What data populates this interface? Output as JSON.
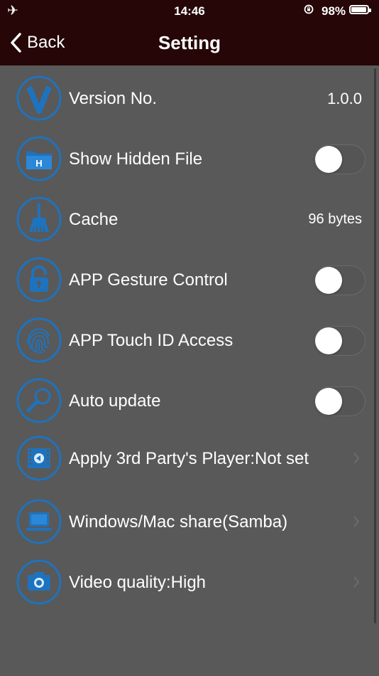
{
  "status_bar": {
    "time": "14:46",
    "battery_pct": "98%",
    "battery_level": 0.98
  },
  "nav": {
    "back_label": "Back",
    "title": "Setting"
  },
  "accent_color": "#1e73be",
  "rows": [
    {
      "icon": "version-v-icon",
      "label": "Version No.",
      "value": "1.0.0"
    },
    {
      "icon": "hidden-folder-icon",
      "label": "Show Hidden File",
      "toggle_on": false
    },
    {
      "icon": "broom-icon",
      "label": "Cache",
      "value": "96 bytes"
    },
    {
      "icon": "padlock-icon",
      "label": "APP Gesture Control",
      "toggle_on": false
    },
    {
      "icon": "fingerprint-icon",
      "label": "APP Touch ID Access",
      "toggle_on": false
    },
    {
      "icon": "magnifier-icon",
      "label": "Auto update",
      "toggle_on": false
    },
    {
      "icon": "film-player-icon",
      "label": "Apply 3rd Party's Player:Not set"
    },
    {
      "icon": "laptop-icon",
      "label": "Windows/Mac share(Samba)"
    },
    {
      "icon": "camera-icon",
      "label": "Video quality:High"
    }
  ]
}
